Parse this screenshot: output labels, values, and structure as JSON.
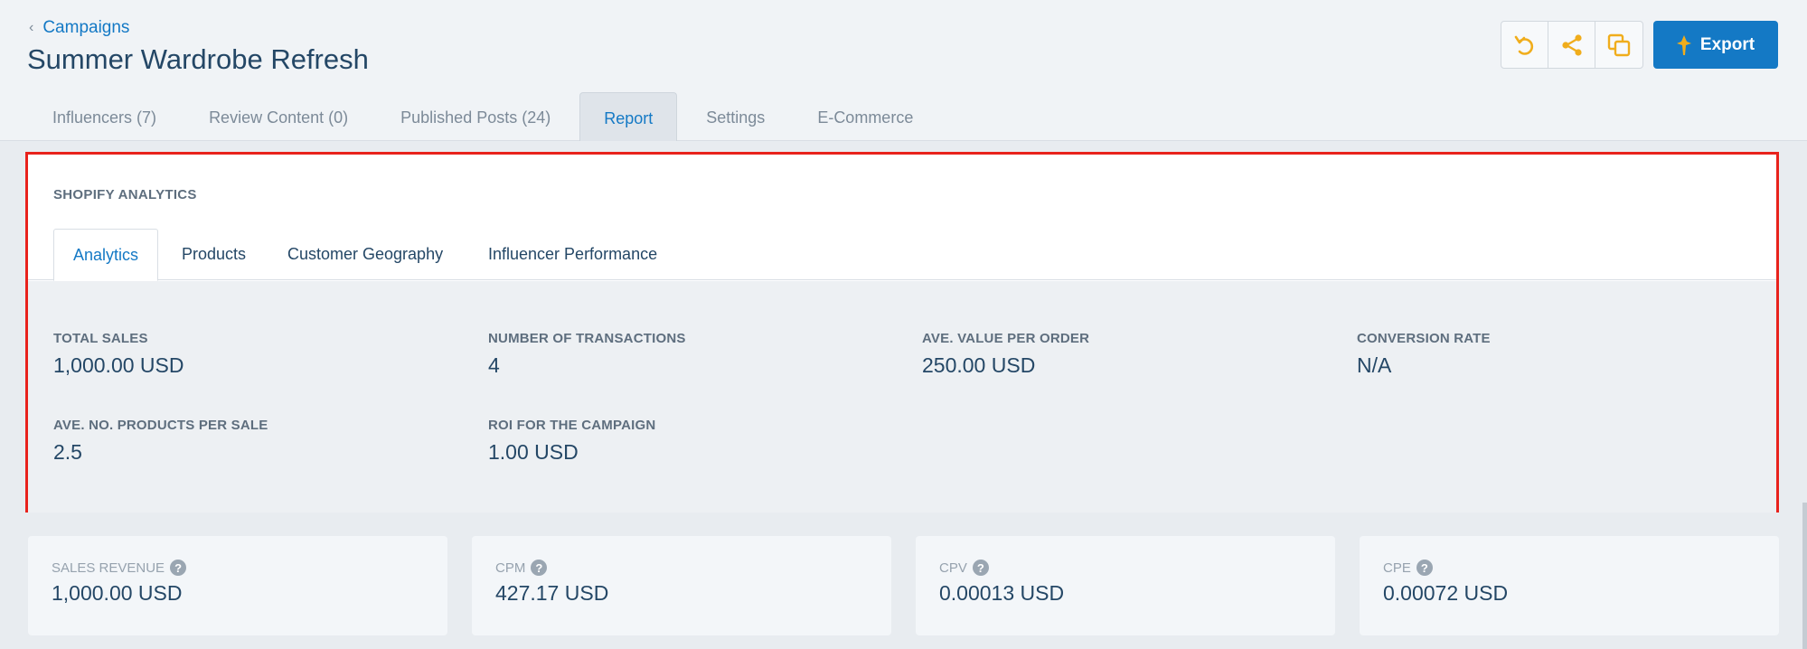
{
  "header": {
    "breadcrumb": "Campaigns",
    "title": "Summer Wardrobe Refresh",
    "export_label": "Export",
    "tabs": [
      {
        "label": "Influencers (7)"
      },
      {
        "label": "Review Content (0)"
      },
      {
        "label": "Published Posts (24)"
      },
      {
        "label": "Report"
      },
      {
        "label": "Settings"
      },
      {
        "label": "E-Commerce"
      }
    ],
    "active_tab": "Report"
  },
  "shopify": {
    "title": "SHOPIFY ANALYTICS",
    "subtabs": [
      {
        "label": "Analytics"
      },
      {
        "label": "Products"
      },
      {
        "label": "Customer Geography"
      },
      {
        "label": "Influencer Performance"
      }
    ],
    "stats": [
      {
        "label": "TOTAL SALES",
        "value": "1,000.00 USD"
      },
      {
        "label": "NUMBER OF TRANSACTIONS",
        "value": "4"
      },
      {
        "label": "AVE. VALUE PER ORDER",
        "value": "250.00 USD"
      },
      {
        "label": "CONVERSION RATE",
        "value": "N/A"
      },
      {
        "label": "AVE. NO. PRODUCTS PER SALE",
        "value": "2.5"
      },
      {
        "label": "ROI FOR THE CAMPAIGN",
        "value": "1.00 USD"
      }
    ]
  },
  "cards": [
    {
      "label": "SALES REVENUE",
      "value": "1,000.00 USD"
    },
    {
      "label": "CPM",
      "value": "427.17 USD"
    },
    {
      "label": "CPV",
      "value": "0.00013 USD"
    },
    {
      "label": "CPE",
      "value": "0.00072 USD"
    }
  ],
  "icons": {
    "undo": "undo-icon",
    "share": "share-icon",
    "duplicate": "duplicate-icon",
    "export": "pin-icon",
    "help": "question-icon"
  },
  "colors": {
    "accent": "#1479c5",
    "icon_yellow": "#f0ad1c",
    "highlight_border": "#e8221c",
    "title": "#244766"
  }
}
